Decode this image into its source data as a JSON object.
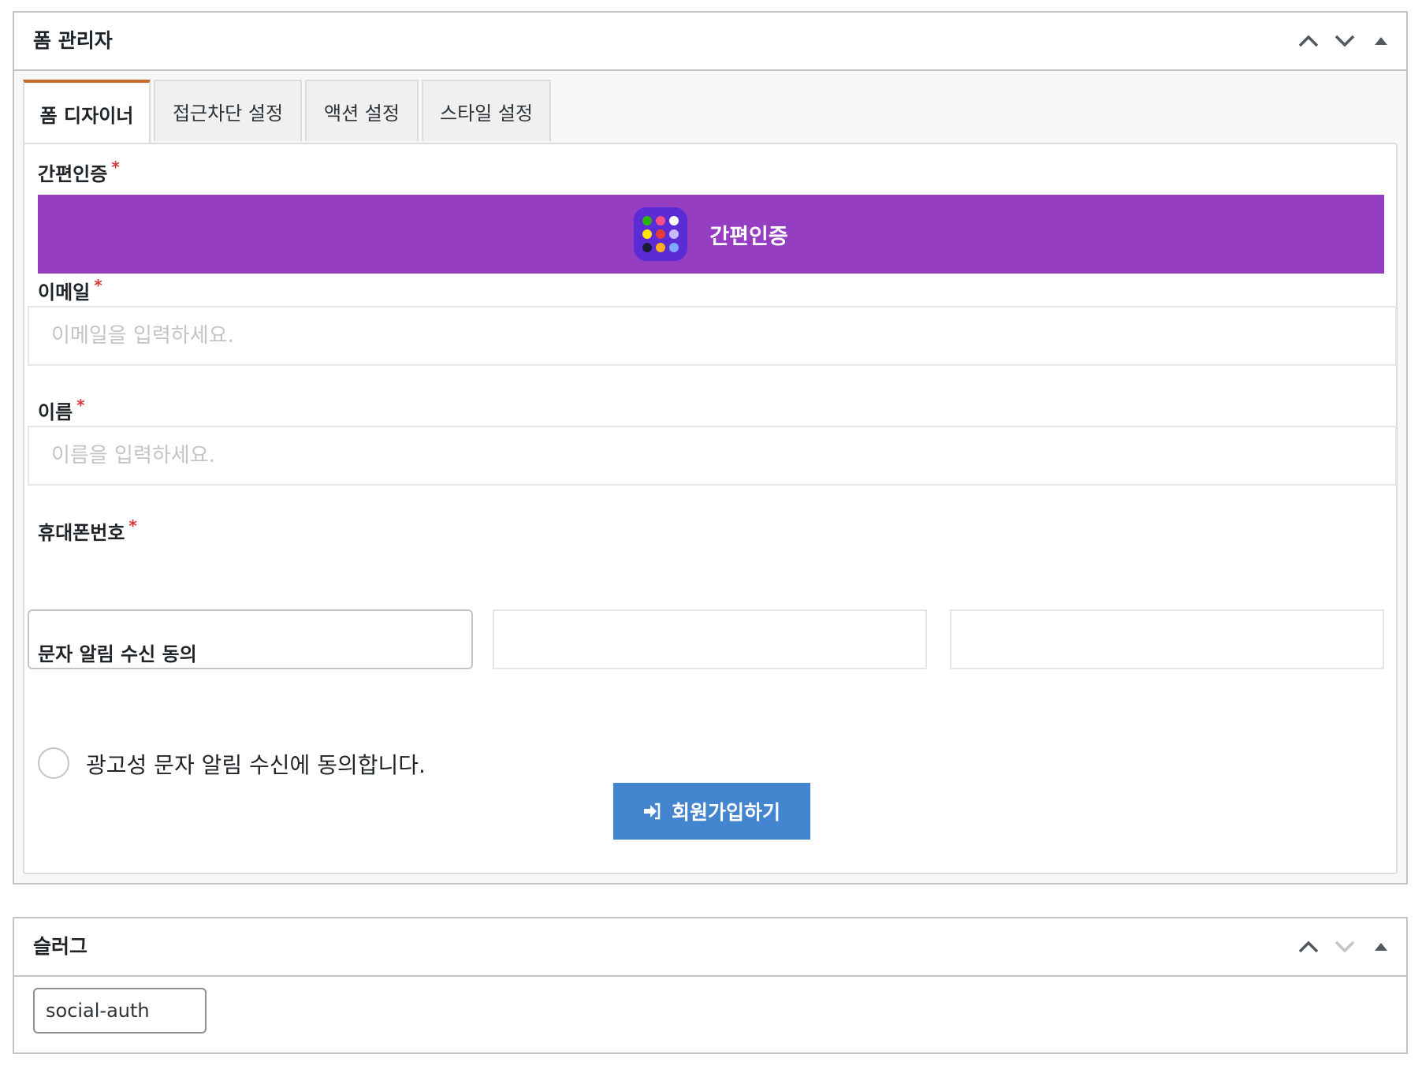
{
  "form_manager": {
    "title": "폼 관리자",
    "tabs": [
      {
        "label": "폼 디자이너"
      },
      {
        "label": "접근차단 설정"
      },
      {
        "label": "액션 설정"
      },
      {
        "label": "스타일 설정"
      }
    ],
    "fields": {
      "sso": {
        "label": "간편인증",
        "required_mark": "*",
        "button_label": "간편인증"
      },
      "email": {
        "label": "이메일",
        "required_mark": "*",
        "placeholder": "이메일을 입력하세요."
      },
      "name": {
        "label": "이름",
        "required_mark": "*",
        "placeholder": "이름을 입력하세요."
      },
      "phone": {
        "label": "휴대폰번호",
        "required_mark": "*"
      },
      "sms_consent": {
        "label": "문자 알림 수신 동의",
        "option_text": "광고성 문자 알림 수신에 동의합니다."
      }
    },
    "submit_label": "회원가입하기"
  },
  "slug_box": {
    "title": "슬러그",
    "value": "social-auth"
  },
  "colors": {
    "sso_button": "#963ec2",
    "submit_button": "#4485cf",
    "required": "#d63638",
    "active_tab_accent": "#c86b2e"
  },
  "icons": [
    "chevron-up-icon",
    "chevron-down-icon",
    "triangle-up-icon",
    "sign-in-icon",
    "app-grid-icon"
  ]
}
